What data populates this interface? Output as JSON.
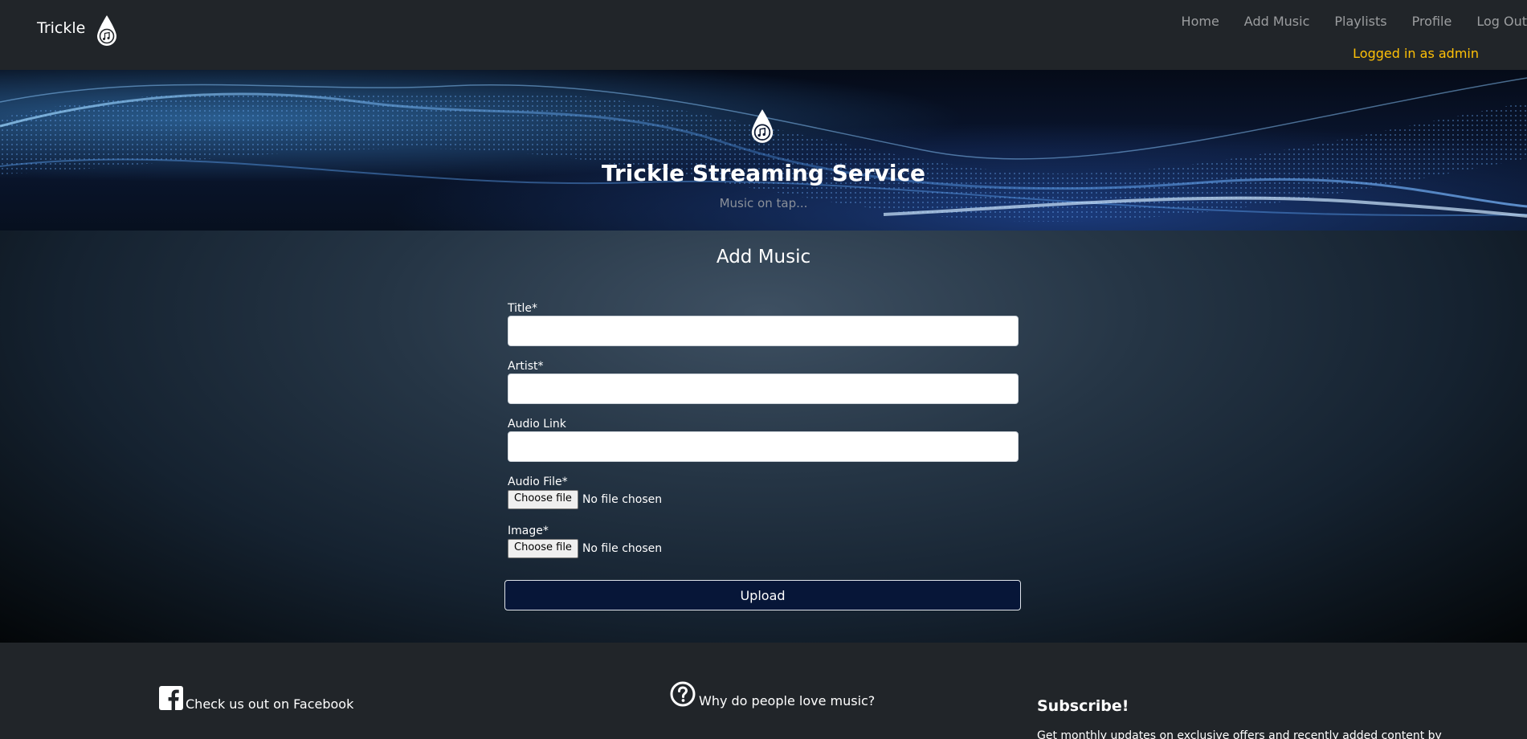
{
  "navbar": {
    "brand": "Trickle",
    "links": [
      "Home",
      "Add Music",
      "Playlists",
      "Profile",
      "Log Out"
    ],
    "logged_in": "Logged in as admin"
  },
  "hero": {
    "title": "Trickle Streaming Service",
    "subtitle": "Music on tap..."
  },
  "main": {
    "title": "Add Music",
    "fields": {
      "title_label": "Title*",
      "artist_label": "Artist*",
      "audio_link_label": "Audio Link",
      "audio_file_label": "Audio File*",
      "image_label": "Image*"
    },
    "file_button": "Choose file",
    "file_status": "No file chosen",
    "upload": "Upload"
  },
  "footer": {
    "facebook": "Check us out on Facebook",
    "why": "Why do people love music?",
    "subscribe_title": "Subscribe!",
    "subscribe_text": "Get monthly updates on exclusive offers and recently added content by"
  },
  "colors": {
    "navbar_bg": "#212529",
    "accent_yellow": "#ffc107",
    "upload_bg": "#071638"
  }
}
